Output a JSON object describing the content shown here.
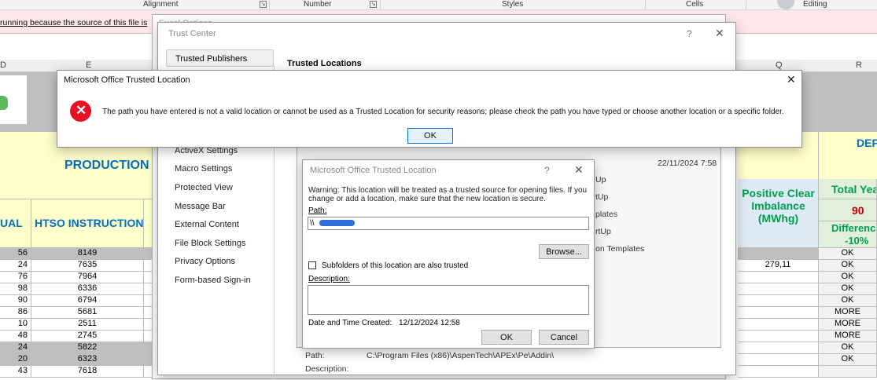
{
  "ribbon": {
    "groups": [
      {
        "label": "Alignment"
      },
      {
        "label": "Number"
      },
      {
        "label": "Styles"
      },
      {
        "label": "Cells"
      },
      {
        "label": "Editing"
      }
    ],
    "message_bar_text": "running because the source of this file is"
  },
  "sheet": {
    "columns": [
      "D",
      "E",
      "Q",
      "R"
    ],
    "header": {
      "production": "PRODUCTION",
      "ual": "UAL",
      "htso": "HTSO INSTRUCTION",
      "positive_clear": "Positive Clear Imbalance (MWhg)",
      "dep": "DEP",
      "total_year": "Total Yea",
      "total_year_value": "90",
      "difference": "Differenc",
      "difference_value": "-10%"
    },
    "rows": [
      {
        "a": "56",
        "e": "8149",
        "q": "",
        "r": "OK",
        "dark": true
      },
      {
        "a": "24",
        "e": "7635",
        "q": "279,11",
        "r": "OK",
        "dark": false
      },
      {
        "a": "76",
        "e": "7964",
        "q": "",
        "r": "OK",
        "dark": false
      },
      {
        "a": "98",
        "e": "6336",
        "q": "",
        "r": "OK",
        "dark": false
      },
      {
        "a": "90",
        "e": "6794",
        "q": "",
        "r": "OK",
        "dark": false
      },
      {
        "a": "86",
        "e": "5681",
        "q": "",
        "r": "MORE",
        "dark": false
      },
      {
        "a": "10",
        "e": "2511",
        "q": "",
        "r": "MORE",
        "dark": false
      },
      {
        "a": "48",
        "e": "2745",
        "q": "",
        "r": "MORE",
        "dark": false
      },
      {
        "a": "24",
        "e": "5822",
        "q": "",
        "r": "OK",
        "dark": true
      },
      {
        "a": "20",
        "e": "6323",
        "q": "",
        "r": "OK",
        "dark": true
      },
      {
        "a": "43",
        "e": "7618",
        "q": "",
        "r": "",
        "dark": false
      }
    ]
  },
  "excel_options": {
    "title": "Excel Options"
  },
  "trust_center": {
    "title": "Trust Center",
    "help": "?",
    "close": "✕",
    "nav": [
      "Trusted Publishers",
      "ActiveX Settings",
      "Macro Settings",
      "Protected View",
      "Message Bar",
      "External Content",
      "File Block Settings",
      "Privacy Options",
      "Form-based Sign-in"
    ],
    "section_title": "Trusted Locations",
    "list_fragments": [
      "Up",
      "tUp",
      "plates",
      "rtUp",
      "on Templates"
    ],
    "list_date": "22/11/2024 7:58",
    "bottom_path_label": "Path:",
    "bottom_path_value": "C:\\Program Files (x86)\\AspenTech\\APEx\\Pe\\Addin\\",
    "bottom_description_label": "Description:"
  },
  "location_dialog": {
    "title": "Microsoft Office Trusted Location",
    "help": "?",
    "close": "✕",
    "warning": "Warning: This location will be treated as a trusted source for opening files. If you change or add a location, make sure that the new location is secure.",
    "path_label": "Path:",
    "path_value": "\\\\",
    "browse": "Browse...",
    "subfolders_label": "Subfolders of this location are also trusted",
    "description_label": "Description:",
    "date_label": "Date and Time Created:",
    "date_value": "12/12/2024 12:58",
    "ok": "OK",
    "cancel": "Cancel"
  },
  "error_dialog": {
    "title": "Microsoft Office Trusted Location",
    "close": "✕",
    "message": "The path you have entered is not a valid location or cannot be used as a Trusted Location for security reasons; please check the path you have typed or choose another location or a specific folder.",
    "ok": "OK"
  },
  "colors": {
    "production_blue": "#0070c0",
    "green": "#00a050",
    "error_red": "#e81123",
    "message_bar": "#fde7e9"
  }
}
